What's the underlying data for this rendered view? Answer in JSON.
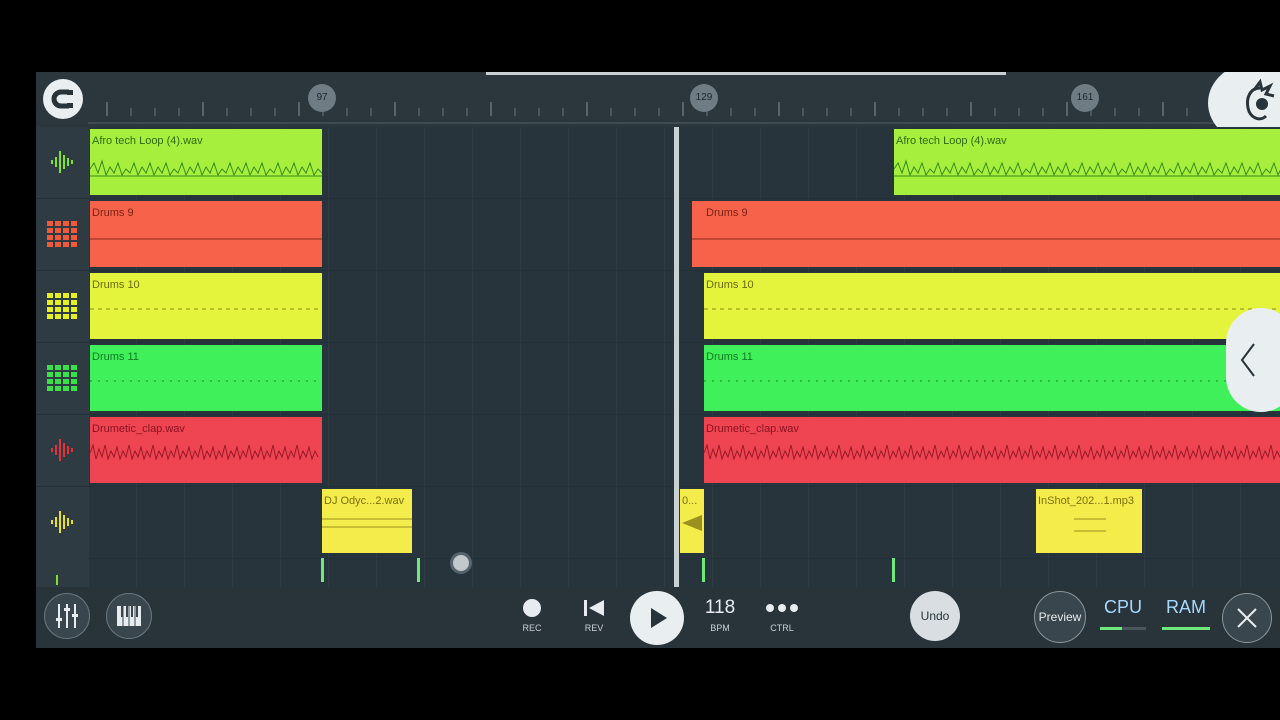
{
  "ruler": {
    "markers": [
      "97",
      "129",
      "161"
    ]
  },
  "tracks": [
    {
      "name": "audio-waveform-icon",
      "color": "#7fe22a"
    },
    {
      "name": "drum-pattern-icon",
      "color": "#f05a3a"
    },
    {
      "name": "drum-pattern-icon",
      "color": "#e4f020"
    },
    {
      "name": "drum-pattern-icon",
      "color": "#39e04a"
    },
    {
      "name": "audio-waveform-icon",
      "color": "#e8303a"
    },
    {
      "name": "audio-waveform-icon",
      "color": "#e8e020"
    }
  ],
  "clips": {
    "afro_a": "Afro tech Loop  (4).wav",
    "afro_b": "Afro tech Loop  (4).wav",
    "drums9_a": "Drums 9",
    "drums9_b": "Drums 9",
    "drums10_a": "Drums 10",
    "drums10_b": "Drums 10",
    "drums11_a": "Drums 11",
    "drums11_b": "Drums 11",
    "clap_a": "Drumetic_clap.wav",
    "clap_b": "Drumetic_clap.wav",
    "dj": "DJ Odyc...2.wav",
    "small": "0...",
    "inshot": "InShot_202...1.mp3"
  },
  "toolbar": {
    "rec": "REC",
    "rev": "REV",
    "bpm_value": "118",
    "bpm": "BPM",
    "ctrl": "CTRL",
    "undo": "Undo",
    "preview": "Preview",
    "cpu": "CPU",
    "ram": "RAM"
  },
  "colors": {
    "lime": "#a6ef3d",
    "orange": "#f6634a",
    "yellow": "#e4f43c",
    "green": "#3ff05a",
    "red": "#ef4452",
    "sample_yellow": "#f4ec4a"
  }
}
